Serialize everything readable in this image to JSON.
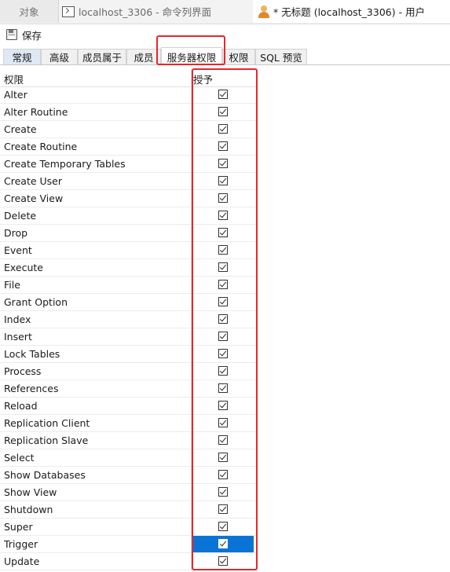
{
  "doc_tabs": [
    {
      "label": "对象"
    },
    {
      "label": "localhost_3306 - 命令列界面",
      "icon": "terminal-icon"
    },
    {
      "label": "* 无标题 (localhost_3306) - 用户",
      "icon": "user-icon"
    }
  ],
  "toolbar": {
    "save_label": "保存"
  },
  "prop_tabs": [
    {
      "label": "常规"
    },
    {
      "label": "高级"
    },
    {
      "label": "成员属于"
    },
    {
      "label": "成员"
    },
    {
      "label": "服务器权限"
    },
    {
      "label": "权限"
    },
    {
      "label": "SQL 预览"
    }
  ],
  "grid": {
    "col_privilege": "权限",
    "col_grant": "授予",
    "rows": [
      {
        "name": "Alter",
        "granted": true
      },
      {
        "name": "Alter Routine",
        "granted": true
      },
      {
        "name": "Create",
        "granted": true
      },
      {
        "name": "Create Routine",
        "granted": true
      },
      {
        "name": "Create Temporary Tables",
        "granted": true
      },
      {
        "name": "Create User",
        "granted": true
      },
      {
        "name": "Create View",
        "granted": true
      },
      {
        "name": "Delete",
        "granted": true
      },
      {
        "name": "Drop",
        "granted": true
      },
      {
        "name": "Event",
        "granted": true
      },
      {
        "name": "Execute",
        "granted": true
      },
      {
        "name": "File",
        "granted": true
      },
      {
        "name": "Grant Option",
        "granted": true
      },
      {
        "name": "Index",
        "granted": true
      },
      {
        "name": "Insert",
        "granted": true
      },
      {
        "name": "Lock Tables",
        "granted": true
      },
      {
        "name": "Process",
        "granted": true
      },
      {
        "name": "References",
        "granted": true
      },
      {
        "name": "Reload",
        "granted": true
      },
      {
        "name": "Replication Client",
        "granted": true
      },
      {
        "name": "Replication Slave",
        "granted": true
      },
      {
        "name": "Select",
        "granted": true
      },
      {
        "name": "Show Databases",
        "granted": true
      },
      {
        "name": "Show View",
        "granted": true
      },
      {
        "name": "Shutdown",
        "granted": true
      },
      {
        "name": "Super",
        "granted": true
      },
      {
        "name": "Trigger",
        "granted": true,
        "selected": true
      },
      {
        "name": "Update",
        "granted": true
      }
    ]
  },
  "colors": {
    "highlight": "#e8262b",
    "selection": "#0a74d6"
  }
}
